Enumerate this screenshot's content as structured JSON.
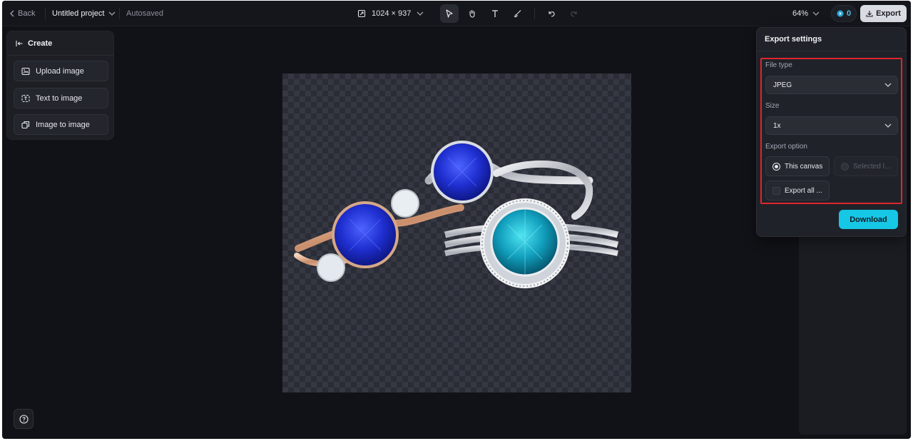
{
  "topbar": {
    "back_label": "Back",
    "project_name": "Untitled project",
    "autosave_status": "Autosaved",
    "canvas_size": "1024 × 937",
    "zoom": "64%",
    "credits": "0",
    "export_label": "Export"
  },
  "left_panel": {
    "title": "Create",
    "items": [
      {
        "label": "Upload image"
      },
      {
        "label": "Text to image"
      },
      {
        "label": "Image to image"
      }
    ]
  },
  "export_settings": {
    "title": "Export settings",
    "file_type_label": "File type",
    "file_type_value": "JPEG",
    "size_label": "Size",
    "size_value": "1x",
    "export_option_label": "Export option",
    "options": [
      {
        "label": "This canvas",
        "selected": true,
        "enabled": true
      },
      {
        "label": "Selected l...",
        "selected": false,
        "enabled": false
      },
      {
        "label": "Export all ...",
        "selected": false,
        "enabled": false
      }
    ],
    "download_label": "Download",
    "highlight_color": "#e0262d"
  },
  "colors": {
    "accent": "#16c7e6",
    "background": "#111217"
  }
}
